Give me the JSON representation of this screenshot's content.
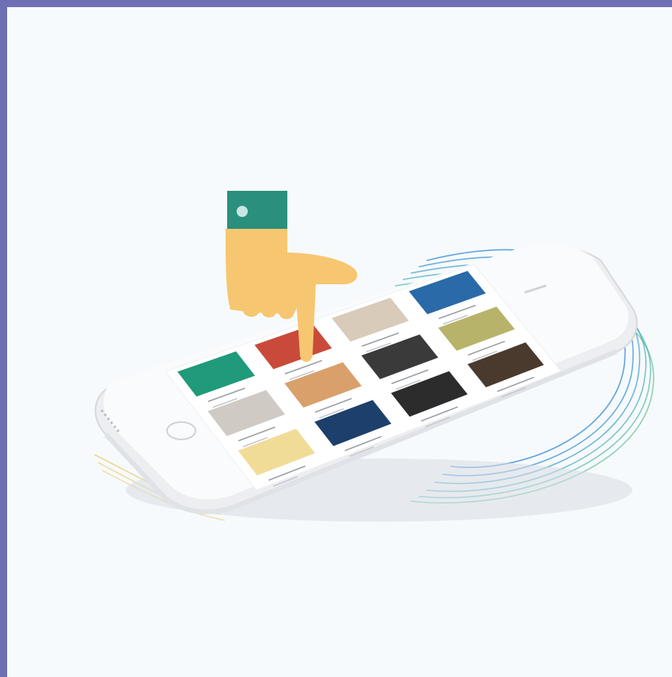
{
  "colors": {
    "frame": "#6f6fb6",
    "canvas": "#f7fafc",
    "phone_body": "#f2f3f5",
    "screen": "#ffffff",
    "hand_skin": "#f7c671",
    "cuff": "#2a8f7d",
    "cuff_button": "#c8e6e4",
    "wave_blue": "#3a8fd6",
    "wave_green": "#35b07a",
    "wave_yellow": "#e9cf7a"
  },
  "icons": {
    "hand": "pointing-hand-icon",
    "device": "smartphone-illustration"
  },
  "tiles": [
    {
      "name": "album-tile-green-flower",
      "color": "#1f9a7a"
    },
    {
      "name": "album-tile-red-car",
      "color": "#c94a3a"
    },
    {
      "name": "album-tile-colorful-grid",
      "color": "#d8cbb9"
    },
    {
      "name": "album-tile-blue-orange",
      "color": "#2a6aa8"
    },
    {
      "name": "album-tile-grey-mug",
      "color": "#cfcac4"
    },
    {
      "name": "album-tile-dancers",
      "color": "#d9a06b"
    },
    {
      "name": "album-tile-dark-text",
      "color": "#3a3a3a"
    },
    {
      "name": "album-tile-green-painting",
      "color": "#b8b36a"
    },
    {
      "name": "album-tile-yellow-poster",
      "color": "#f1dc97"
    },
    {
      "name": "album-tile-blue-forest",
      "color": "#1d3f6b"
    },
    {
      "name": "album-tile-dark-portrait",
      "color": "#2c2c2c"
    },
    {
      "name": "album-tile-dark-scene",
      "color": "#4a3a2e"
    }
  ]
}
